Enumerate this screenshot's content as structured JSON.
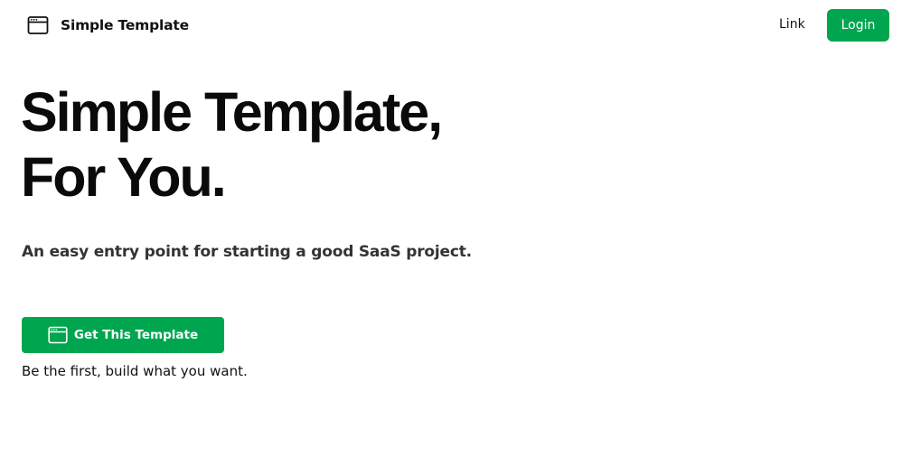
{
  "navbar": {
    "brand": {
      "icon": "browser-window-icon",
      "name": "Simple Template"
    },
    "link_label": "Link",
    "login_label": "Login"
  },
  "hero": {
    "title_line1": "Simple Template,",
    "title_line2": "For You.",
    "subtitle": "An easy entry point for starting a good SaaS project.",
    "cta": {
      "icon": "browser-window-icon",
      "label": "Get This Template"
    },
    "tagline": "Be the first, build what you want."
  },
  "colors": {
    "accent": "#00a64f",
    "text": "#111111",
    "subtitle": "#333333",
    "background": "#ffffff"
  }
}
